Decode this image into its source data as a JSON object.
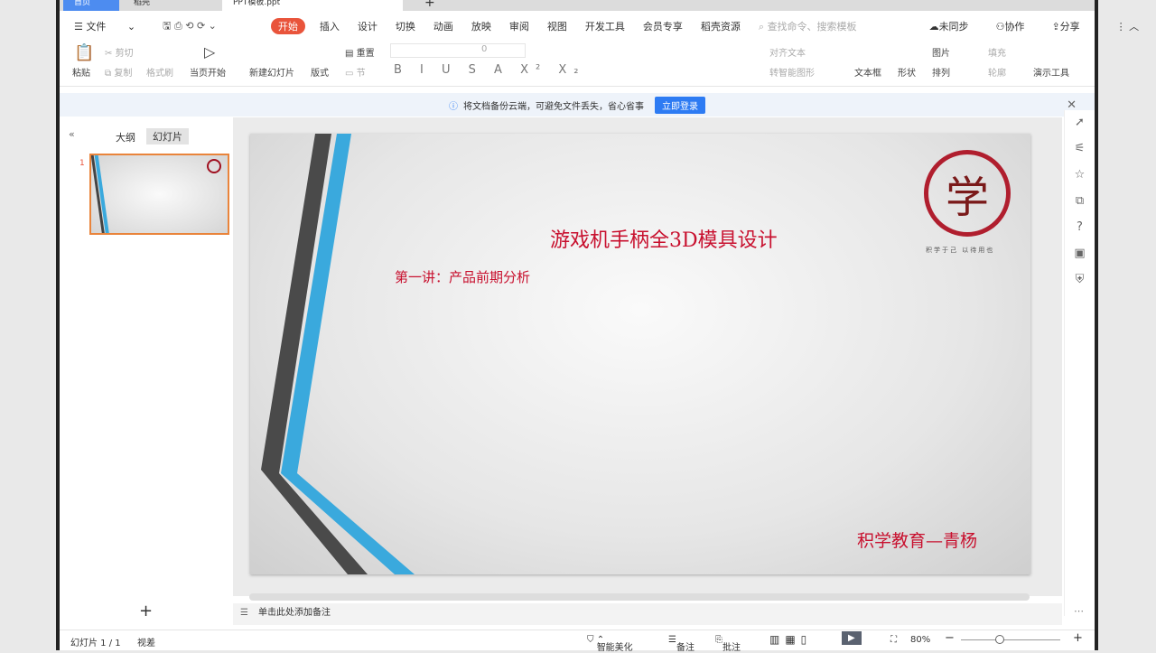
{
  "tabs": [
    {
      "label": "首页"
    },
    {
      "label": "稻壳"
    },
    {
      "label": "PPT模板.ppt"
    }
  ],
  "menu": {
    "file": "文件",
    "items": [
      "开始",
      "插入",
      "设计",
      "切换",
      "动画",
      "放映",
      "审阅",
      "视图",
      "开发工具",
      "会员专享",
      "稻壳资源"
    ],
    "search_placeholder": "查找命令、搜索模板",
    "sync": "未同步",
    "collab": "协作",
    "share": "分享"
  },
  "toolbar": {
    "paste": "粘贴",
    "cut": "剪切",
    "copy": "复制",
    "format_painter": "格式刷",
    "play_from_current": "当页开始",
    "new_slide": "新建幻灯片",
    "layout": "版式",
    "reset": "重置",
    "section": "节",
    "font_size": "0",
    "align_text": "对齐文本",
    "smart_art": "转智能图形",
    "text_box": "文本框",
    "shape": "形状",
    "picture": "图片",
    "arrange": "排列",
    "fill": "填充",
    "outline": "轮廓",
    "presenter_tools": "演示工具"
  },
  "notice": {
    "text": "将文档备份云端，可避免文件丢失，省心省事",
    "button": "立即登录"
  },
  "panel": {
    "outline_tab": "大纲",
    "slides_tab": "幻灯片",
    "slide_number": "1"
  },
  "slide": {
    "title": "游戏机手柄全3D模具设计",
    "subtitle": "第一讲：产品前期分析",
    "author": "积学教育—青杨",
    "logo_char": "学",
    "logo_caption": "积学于己  以待用也"
  },
  "notes_placeholder": "单击此处添加备注",
  "status": {
    "slide_count": "幻灯片 1 / 1",
    "theme": "视差",
    "beautify": "智能美化",
    "notes": "备注",
    "comments": "批注",
    "zoom": "80%"
  },
  "colors": {
    "accent": "#e9543b",
    "title_red": "#c8102e",
    "blue_stripe": "#3aa9dd"
  },
  "zoom_level": 80
}
